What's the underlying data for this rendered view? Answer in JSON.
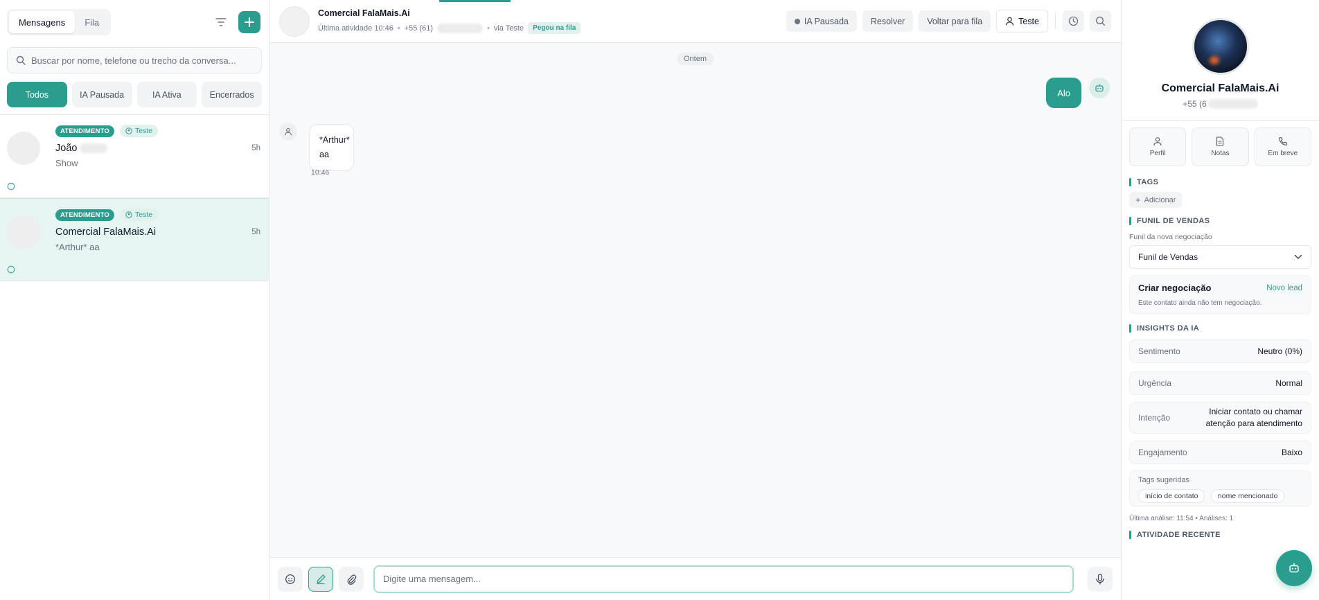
{
  "left": {
    "tabs": {
      "messages": "Mensagens",
      "queue": "Fila"
    },
    "search_placeholder": "Buscar por nome, telefone ou trecho da conversa...",
    "filters": [
      "Todos",
      "IA Pausada",
      "IA Ativa",
      "Encerrados"
    ],
    "conversations": [
      {
        "status": "ATENDIMENTO",
        "tag": "Teste",
        "name": "João",
        "preview": "Show",
        "time": "5h"
      },
      {
        "status": "ATENDIMENTO",
        "tag": "Teste",
        "name": "Comercial FalaMais.Ai",
        "preview": "*Arthur* aa",
        "time": "5h"
      }
    ]
  },
  "header": {
    "name": "Comercial FalaMais.Ai",
    "last_activity": "Última atividade 10:46",
    "phone": "+55 (61)",
    "via": "via Teste",
    "queue_badge": "Pegou na fila",
    "ai_paused": "IA Pausada",
    "resolve": "Resolver",
    "back_to_queue": "Voltar para fila",
    "agent": "Teste"
  },
  "chat": {
    "day_label": "Ontem",
    "outgoing": "Alo",
    "incoming_line1": "*Arthur*",
    "incoming_line2": "aa",
    "incoming_time": "10:46",
    "composer_placeholder": "Digite uma mensagem..."
  },
  "right": {
    "name": "Comercial FalaMais.Ai",
    "phone": "+55 (6",
    "tabs": [
      "Perfil",
      "Notas",
      "Em breve"
    ],
    "tags_title": "TAGS",
    "add_tag": "Adicionar",
    "funnel_title": "FUNIL DE VENDAS",
    "funnel_sub": "Funil da nova negociação",
    "funnel_value": "Funil de Vendas",
    "deal_title": "Criar negociação",
    "deal_link": "Novo lead",
    "deal_text": "Este contato ainda não tem negociação.",
    "insights_title": "INSIGHTS DA IA",
    "insights": [
      {
        "k": "Sentimento",
        "v": "Neutro (0%)"
      },
      {
        "k": "Urgência",
        "v": "Normal"
      },
      {
        "k": "Intenção",
        "v": "Iniciar contato ou chamar atenção para atendimento"
      },
      {
        "k": "Engajamento",
        "v": "Baixo"
      }
    ],
    "suggested_title": "Tags sugeridas",
    "suggested": [
      "início de contato",
      "nome mencionado"
    ],
    "last_analysis": "Última análise: 11:54 • Análises: 1",
    "recent_title": "ATIVIDADE RECENTE"
  },
  "colors": {
    "accent": "#2a9d8f"
  }
}
